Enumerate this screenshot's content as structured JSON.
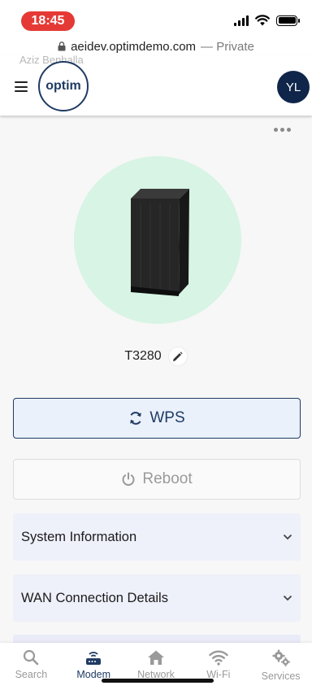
{
  "status_bar": {
    "time": "18:45"
  },
  "browser": {
    "domain": "aeidev.optimdemo.com",
    "mode": "— Private"
  },
  "header": {
    "ghost_text": "Aziz Benhalla",
    "logo_text": "optim",
    "avatar_initials": "YL"
  },
  "device": {
    "name": "T3280",
    "circle_color": "#d7f4e4",
    "image_icon": "modem-icon"
  },
  "actions": {
    "wps_label": "WPS",
    "reboot_label": "Reboot"
  },
  "sections": [
    {
      "label": "System Information"
    },
    {
      "label": "WAN Connection Details"
    }
  ],
  "bottom_nav": {
    "items": [
      {
        "label": "Search",
        "icon": "search-icon"
      },
      {
        "label": "Modem",
        "icon": "modem-icon"
      },
      {
        "label": "Network",
        "icon": "home-icon"
      },
      {
        "label": "Wi-Fi",
        "icon": "wifi-icon"
      },
      {
        "label": "Services",
        "icon": "gears-icon"
      }
    ],
    "active": "Modem"
  },
  "colors": {
    "brand": "#1f3b63",
    "accent_bg": "#eaf1fb",
    "accordion_bg": "#eef0fa",
    "status_red": "#e53935"
  }
}
